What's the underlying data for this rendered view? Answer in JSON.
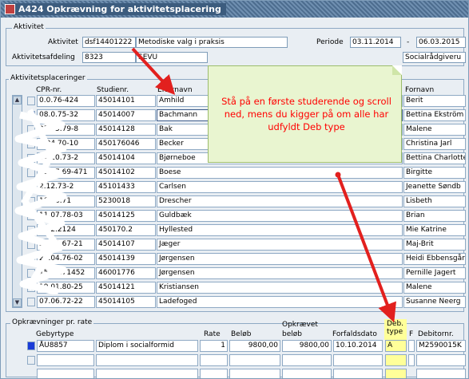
{
  "window": {
    "title": "A424 Opkrævning for aktivitetsplacering"
  },
  "aktivitet": {
    "legend": "Aktivitet",
    "aktivitet_label": "Aktivitet",
    "aktivitet_code": "dsf14401222",
    "aktivitet_name": "Metodiske valg i praksis",
    "periode_label": "Periode",
    "periode_from": "03.11.2014",
    "periode_sep": "-",
    "periode_to": "06.03.2015",
    "afdeling_label": "Aktivitetsafdeling",
    "afdeling_code": "8323",
    "afdeling_name": "SEVU",
    "afdeling_extra": "Socialrådgiveru"
  },
  "placeringer": {
    "legend": "Aktivitetsplaceringer",
    "headers": {
      "cpr": "CPR-nr.",
      "studienr": "Studienr.",
      "efternavn": "Efternavn",
      "fornavn": "Fornavn"
    },
    "rows": [
      {
        "cpr": "0.0.76-424",
        "studienr": "45014101",
        "efternavn": "Amhild",
        "fornavn": "Berit"
      },
      {
        "cpr": "08.0.75-32",
        "studienr": "45014007",
        "efternavn": "Bachmann",
        "fornavn": "Bettina Ekström"
      },
      {
        "cpr": "25.05.79-8",
        "studienr": "45014128",
        "efternavn": "Bak",
        "fornavn": "Malene"
      },
      {
        "cpr": "1.04.70-10",
        "studienr": "450176046",
        "efternavn": "Becker",
        "fornavn": "Christina Jarl"
      },
      {
        "cpr": "04.10.73-2",
        "studienr": "45014104",
        "efternavn": "Bjørneboe",
        "fornavn": "Bettina Charlotte"
      },
      {
        "cpr": "21.07.69-471",
        "studienr": "45014102",
        "efternavn": "Boese",
        "fornavn": "Birgitte"
      },
      {
        "cpr": "2.12.73-2",
        "studienr": "45101433",
        "efternavn": "Carlsen",
        "fornavn": "Jeanette Søndb"
      },
      {
        "cpr": "19.06.71",
        "studienr": "5230018",
        "efternavn": "Drescher",
        "fornavn": "Lisbeth"
      },
      {
        "cpr": "11.07.78-03",
        "studienr": "45014125",
        "efternavn": "Guldbæk",
        "fornavn": "Brian"
      },
      {
        "cpr": "1.02.2124",
        "studienr": "450170.2",
        "efternavn": "Hyllested",
        "fornavn": "Mie Katrine"
      },
      {
        "cpr": "22.01.67-21",
        "studienr": "45014107",
        "efternavn": "Jæger",
        "fornavn": "Maj-Brit"
      },
      {
        "cpr": "27.04.76-02",
        "studienr": "45014139",
        "efternavn": "Jørgensen",
        "fornavn": "Heidi Ebbensgår"
      },
      {
        "cpr": "15.06.71452",
        "studienr": "46001776",
        "efternavn": "Jørgensen",
        "fornavn": "Pernille Jagert"
      },
      {
        "cpr": "19.01.80-25",
        "studienr": "45014121",
        "efternavn": "Kristiansen",
        "fornavn": "Malene"
      },
      {
        "cpr": "07.06.72-22",
        "studienr": "45014105",
        "efternavn": "Ladefoged",
        "fornavn": "Susanne Neerg"
      }
    ]
  },
  "callout": {
    "text": "Stå på en første studerende og scroll ned, mens du kigger på  om alle har udfyldt Deb type"
  },
  "opkraevning": {
    "legend": "Opkrævninger pr. rate",
    "headers": {
      "gebyrtype": "Gebyrtype",
      "rate": "Rate",
      "beloeb": "Beløb",
      "opkraevet_top": "Opkrævet",
      "opkraevet_bottom": "beløb",
      "forfaldsdato": "Forfaldsdato",
      "deb_top": "Deb.",
      "deb_bottom": "type",
      "f": "F",
      "debitornr": "Debitornr."
    },
    "row": {
      "gebyrtype": "ÅU8857",
      "description": "Diplom i socialformid",
      "rate": "1",
      "beloeb": "9800,00",
      "opkraevet": "9800,00",
      "forfaldsdato": "10.10.2014",
      "deb_type": "A",
      "debitornr": "M2590015K"
    }
  },
  "colors": {
    "highlight": "#ffff99",
    "arrow": "#e2201e",
    "callout_bg": "#e9f5d0",
    "callout_text": "#ff0000",
    "active_marker": "#1a3cd8"
  }
}
